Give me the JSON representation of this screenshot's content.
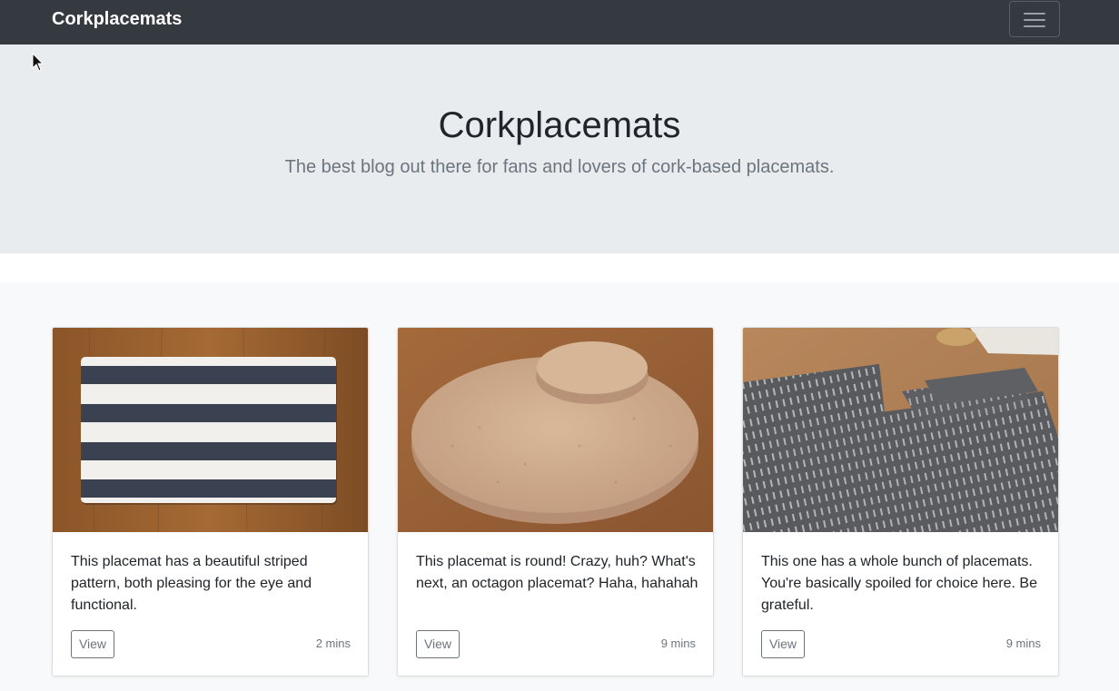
{
  "navbar": {
    "brand": "Corkplacemats",
    "toggle_icon": "hamburger-menu-icon"
  },
  "hero": {
    "title": "Corkplacemats",
    "subtitle": "The best blog out there for fans and lovers of cork-based placemats."
  },
  "cards": [
    {
      "image": "striped-placemat-image",
      "text": "This placemat has a beautiful striped pattern, both pleasing for the eye and functional.",
      "button": "View",
      "time": "2 mins"
    },
    {
      "image": "round-cork-placemat-image",
      "text": "This placemat is round! Crazy, huh? What's next, an octagon placemat? Haha, hahahah",
      "button": "View",
      "time": "9 mins"
    },
    {
      "image": "grey-patterned-placemats-image",
      "text": "This one has a whole bunch of placemats. You're basically spoiled for choice here. Be grateful.",
      "button": "View",
      "time": "9 mins"
    }
  ],
  "colors": {
    "navbar_bg": "#343a40",
    "jumbotron_bg": "#e9ecef",
    "album_bg": "#f8f9fa",
    "muted_text": "#6c757d"
  }
}
